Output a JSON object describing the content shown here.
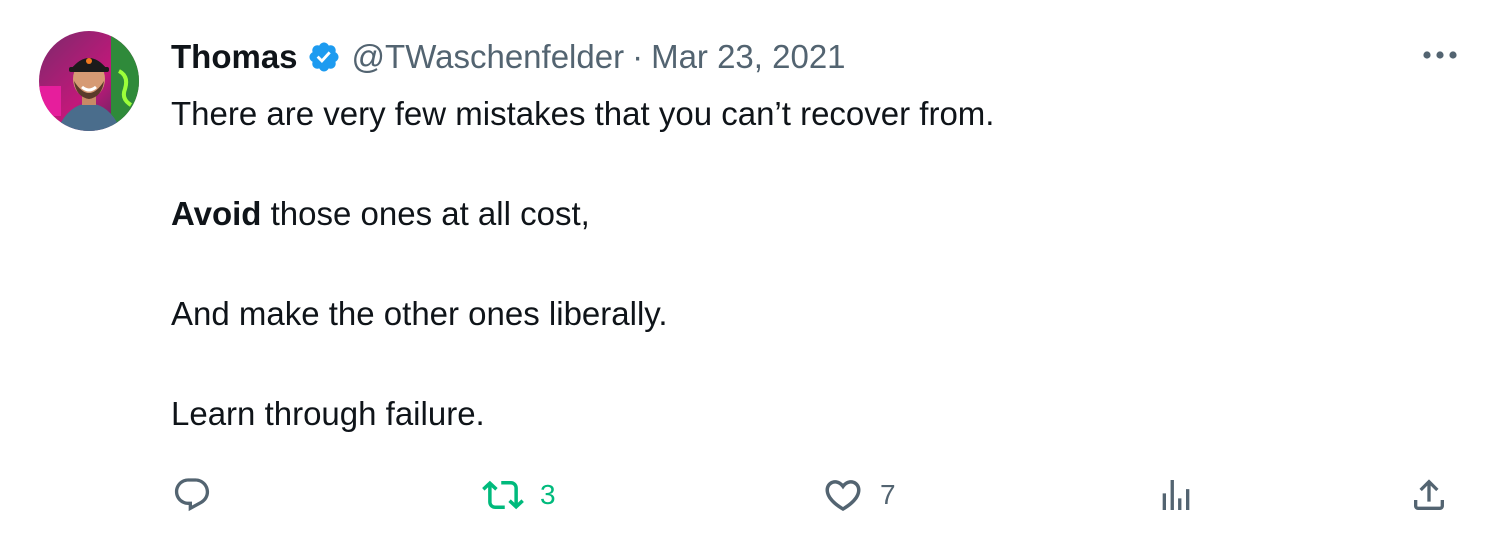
{
  "author": {
    "display_name": "Thomas",
    "handle": "@TWaschenfelder",
    "separator": "·",
    "date": "Mar 23, 2021",
    "verified": true,
    "avatar_icon": "profile-photo"
  },
  "tweet": {
    "line1": "There are very few mistakes that you can’t recover from.",
    "line2_bold": "Avoid",
    "line2_rest": " those ones at all cost,",
    "line3": "And make the other ones liberally.",
    "line4": "Learn through failure."
  },
  "actions": {
    "reply": {
      "icon": "reply-icon",
      "count": ""
    },
    "retweet": {
      "icon": "retweet-icon",
      "count": "3",
      "color": "#00ba7c"
    },
    "like": {
      "icon": "heart-icon",
      "count": "7"
    },
    "views": {
      "icon": "analytics-icon",
      "count": ""
    },
    "share": {
      "icon": "share-icon"
    }
  },
  "colors": {
    "text": "#0f1419",
    "secondary": "#536471",
    "verified": "#1d9bf0",
    "retweet_active": "#00ba7c"
  }
}
